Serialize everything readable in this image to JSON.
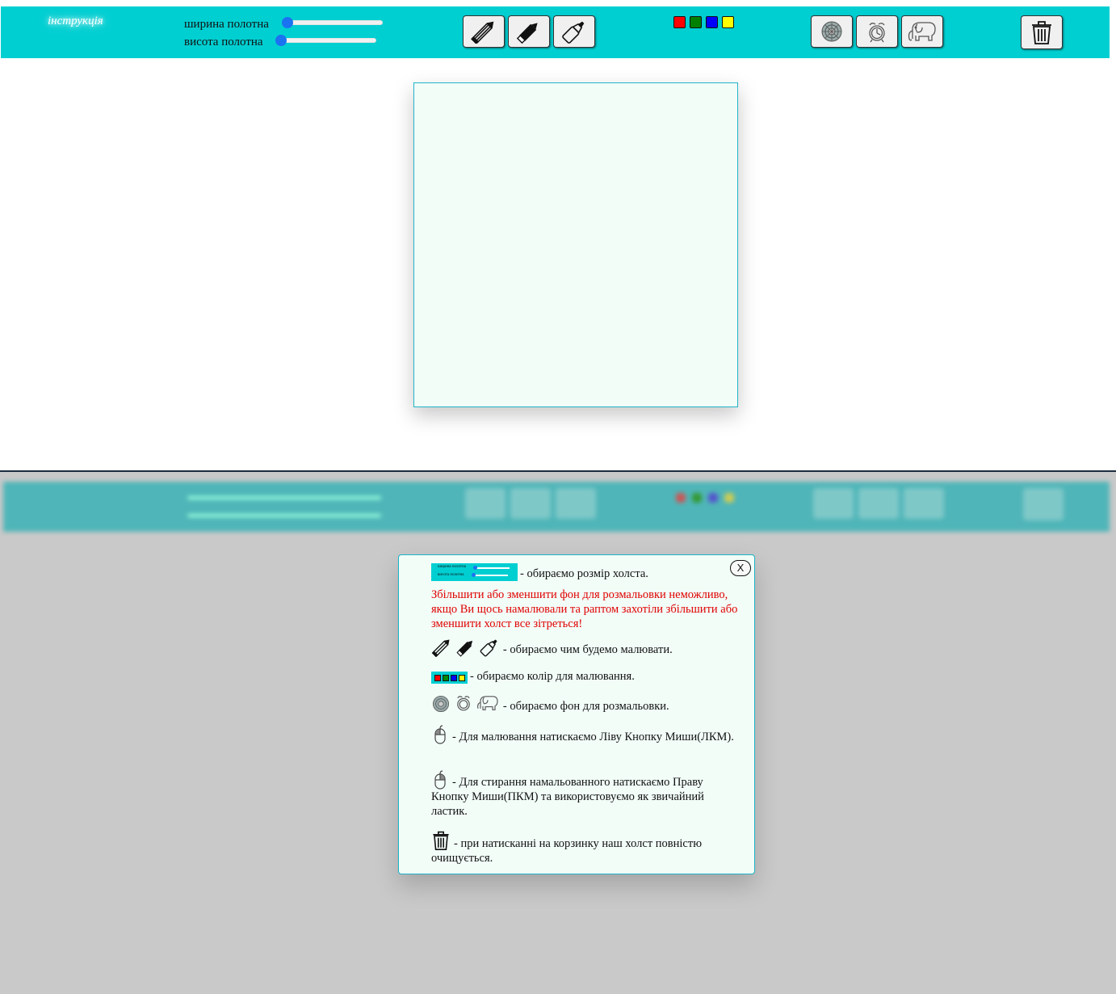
{
  "toolbar": {
    "instructions_link": "інструкція",
    "width_label": "ширина полотна",
    "height_label": "висота полотна",
    "width_value": 0,
    "height_value": 0,
    "tools": [
      {
        "icon": "pencil-icon"
      },
      {
        "icon": "marker-icon"
      },
      {
        "icon": "highlighter-icon"
      }
    ],
    "colors": [
      "#ff0000",
      "#008000",
      "#0000ff",
      "#ffff00"
    ],
    "backgrounds": [
      {
        "icon": "mandala-icon"
      },
      {
        "icon": "alarm-clock-icon"
      },
      {
        "icon": "elephant-icon"
      }
    ],
    "clear_icon": "trash-icon"
  },
  "modal": {
    "close_label": "X",
    "line_size": "- обираємо розмір холста.",
    "mini_width_label": "ширина полотна",
    "mini_height_label": "висота полотна",
    "warning": "Збільшити або зменшити фон для розмальовки неможливо, якщо Ви щось намалювали та раптом захотіли збільшити або зменшити холст все зітреться!",
    "line_tools": "- обираємо чим будемо малювати.",
    "line_colors": "- обираємо колір для малювання.",
    "line_backgrounds": "- обираємо фон для розмальовки.",
    "line_draw": "- Для малювання натискаємо Ліву Кнопку Миши(ЛКМ).",
    "line_erase": "- Для стирання намальованного натискаємо Праву Кнопку Миши(ПКМ) та використовуємо як звичайний ластик.",
    "line_clear": "- при натисканні на корзинку наш холст повністю очищується."
  }
}
